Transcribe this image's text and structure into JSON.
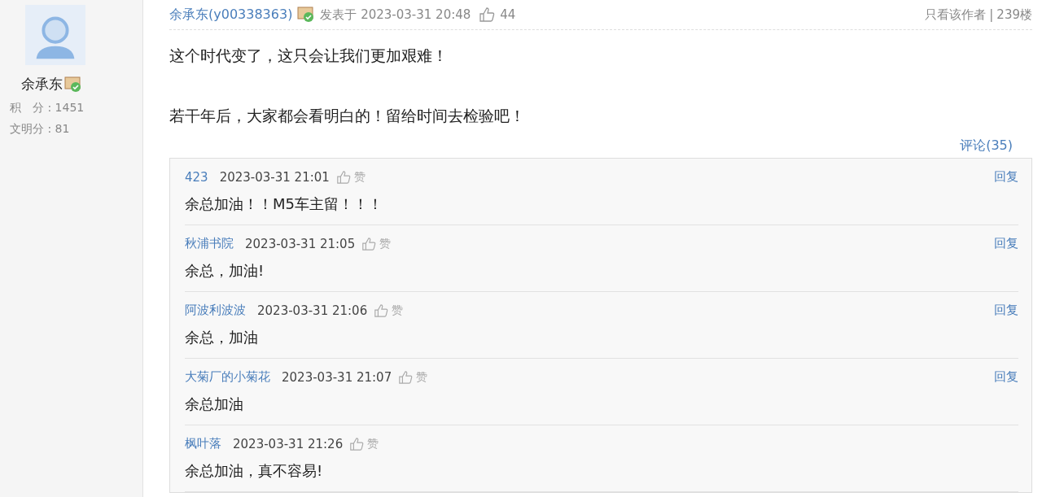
{
  "author": {
    "name": "余承东",
    "stats": [
      "积　分 : 1451",
      "文明分 : 81"
    ]
  },
  "post": {
    "author": "余承东(y00338363)",
    "posted_prefix": "发表于",
    "time": "2023-03-31 20:48",
    "likes": "44",
    "only_author": "只看该作者",
    "separator": "|",
    "floor": "239楼",
    "paragraphs": [
      "这个时代变了，这只会让我们更加艰难！",
      "若干年后，大家都会看明白的！留给时间去检验吧！"
    ],
    "comments_link": "评论(35)"
  },
  "comments": [
    {
      "user": "423",
      "time": "2023-03-31 21:01",
      "like": "赞",
      "reply": "回复",
      "text": "余总加油！！M5车主留！！！"
    },
    {
      "user": "秋浦书院",
      "time": "2023-03-31 21:05",
      "like": "赞",
      "reply": "回复",
      "text": "余总，加油!"
    },
    {
      "user": "阿波利波波",
      "time": "2023-03-31 21:06",
      "like": "赞",
      "reply": "回复",
      "text": "余总，加油"
    },
    {
      "user": "大菊厂的小菊花",
      "time": "2023-03-31 21:07",
      "like": "赞",
      "reply": "回复",
      "text": "余总加油"
    },
    {
      "user": "枫叶落",
      "time": "2023-03-31 21:26",
      "like": "赞",
      "text": "余总加油，真不容易!"
    }
  ]
}
